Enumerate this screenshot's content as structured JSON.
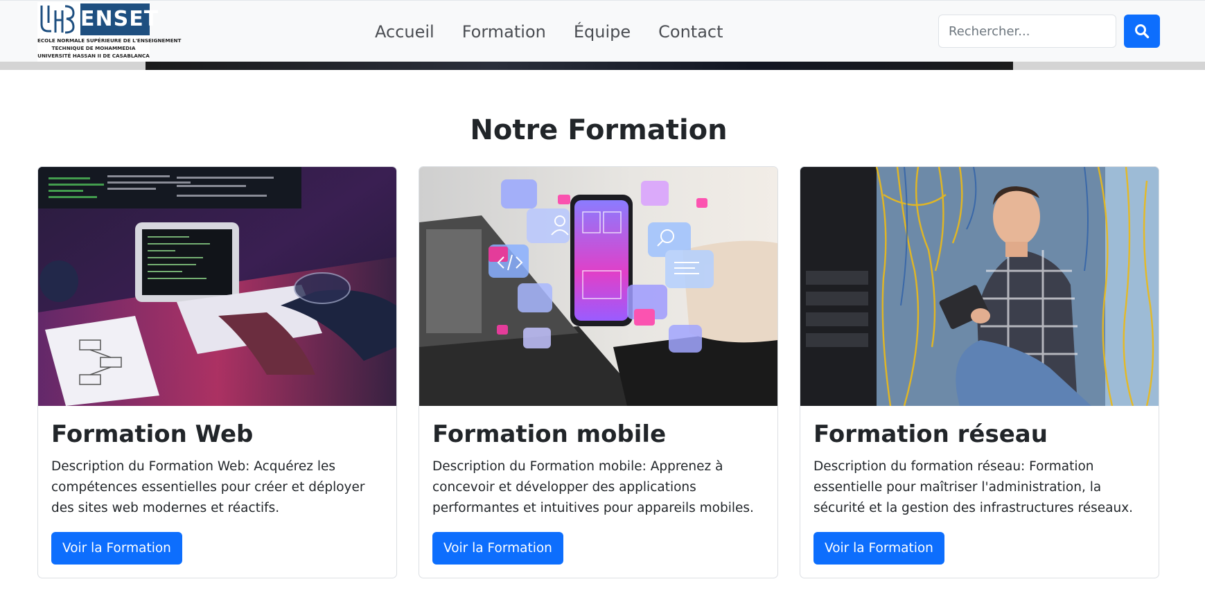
{
  "logo": {
    "brand": "ENSET",
    "line1": "ECOLE NORMALE SUPÉRIEURE DE L'ENSEIGNEMENT",
    "line2": "TECHNIQUE DE MOHAMMEDIA",
    "line3": "UNIVERSITÉ HASSAN II DE CASABLANCA"
  },
  "nav": {
    "links": [
      "Accueil",
      "Formation",
      "Équipe",
      "Contact"
    ]
  },
  "search": {
    "placeholder": "Rechercher...",
    "button_icon": "search-icon"
  },
  "section": {
    "title": "Notre Formation"
  },
  "cards": [
    {
      "title": "Formation Web",
      "text": "Description du Formation Web: Acquérez les compétences essentielles pour créer et déployer des sites web modernes et réactifs.",
      "button": "Voir la Formation"
    },
    {
      "title": "Formation mobile",
      "text": "Description du Formation mobile: Apprenez à concevoir et développer des applications performantes et intuitives pour appareils mobiles.",
      "button": "Voir la Formation"
    },
    {
      "title": "Formation réseau",
      "text": "Description du formation réseau: Formation essentielle pour maîtriser l'administration, la sécurité et la gestion des infrastructures réseaux.",
      "button": "Voir la Formation"
    }
  ],
  "colors": {
    "primary": "#0d6efd",
    "navbar_bg": "#f8f9fa",
    "logo_blue": "#1e4f80",
    "text": "#212529"
  }
}
